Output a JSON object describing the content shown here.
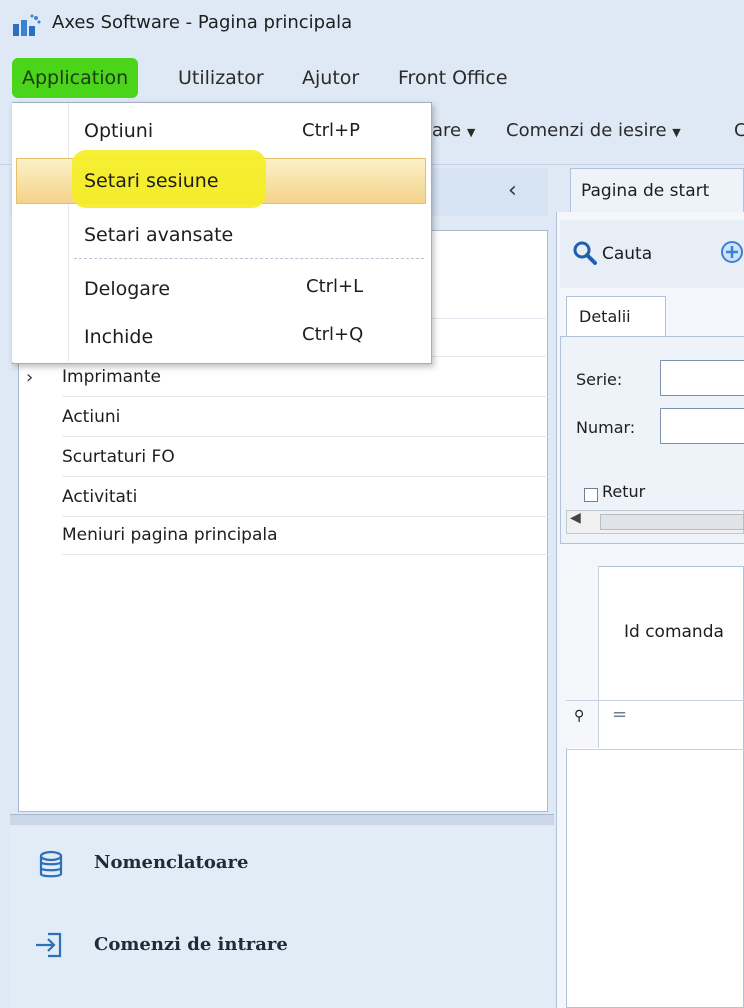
{
  "window": {
    "title": "Axes Software - Pagina principala"
  },
  "menubar": {
    "items": [
      "Application",
      "Utilizator",
      "Ajutor",
      "Front Office"
    ]
  },
  "toolbar": {
    "partial_item": "are",
    "item_comenzi_iesire": "Comenzi de iesire",
    "partial_tail": "C"
  },
  "dropdown": {
    "items": [
      {
        "label": "Optiuni",
        "shortcut": "Ctrl+P"
      },
      {
        "label": "Setari sesiune",
        "shortcut": ""
      },
      {
        "label": "Setari avansate",
        "shortcut": ""
      },
      {
        "label": "Delogare",
        "shortcut": "Ctrl+L"
      },
      {
        "label": "Inchide",
        "shortcut": "Ctrl+Q"
      }
    ]
  },
  "left_panel": {
    "tree_items": [
      "Imprimante",
      "Actiuni",
      "Scurtaturi FO",
      "Activitati",
      "Meniuri pagina principala"
    ],
    "nav": {
      "nomenclatoare": "Nomenclatoare",
      "comenzi_intrare": "Comenzi de intrare"
    }
  },
  "right_panel": {
    "tab_title": "Pagina de start",
    "search_label": "Cauta",
    "details_tab": "Detalii",
    "serie_label": "Serie:",
    "numar_label": "Numar:",
    "retur_label": "Retur",
    "grid_header": "Id comanda",
    "filter_op": "="
  },
  "colors": {
    "menu_highlight": "#4ad41a",
    "marker_yellow": "#f4ee21",
    "hover_gold": "#f4d38a"
  }
}
